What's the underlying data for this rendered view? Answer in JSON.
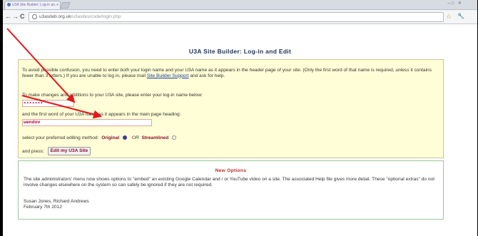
{
  "browser": {
    "tab_title": "U3A Site Builder: Log-in an...",
    "tab_close": "×",
    "window_controls": "–□ ✕",
    "back_icon": "←",
    "forward_icon": "→",
    "reload_icon": "C",
    "url_host": "u3asiteb.org.uk",
    "url_path": "/u3asites/code/login.php",
    "star_icon": "☆",
    "wrench_icon": "🔧"
  },
  "page": {
    "title": "U3A Site Builder: Log-in and Edit",
    "login": {
      "intro_before": "To avoid possible confusion, you need to enter ",
      "intro_em1": "both",
      "intro_mid1": " your login name and your U3A name as it appears in the header page of your site. (Only the first word of that name is required, ",
      "intro_em2": "unless",
      "intro_mid2": " it contains fewer than 3 letters.) If you are unable to log in, please mail ",
      "support_link": "Site Builder Support",
      "intro_after": " and ask for help.",
      "login_label": "To make changes and additions to your U3A site, please enter your log-in name below:",
      "login_value": "•••••••",
      "u3a_label": "and the first word of your U3A name as it appears in the main page heading:",
      "u3a_value": "wendov",
      "method_label": "select your preferred editing method:",
      "option_original": "Original",
      "or_text": "OR",
      "option_streamlined": "Streamlined",
      "press_label": "and press:",
      "submit_label": "Edit my U3A Site"
    },
    "news": {
      "title": "New Options",
      "text": "The site administrators' menu now shows options to \"embed\" an existing Google Calendar and / or YouTube video on a site. The associated Help file gives more detail. These \"optional extras\" do not involve changes elsewhere on the system so can safely be ignored if they are not required.",
      "authors": "Susan Jones, Richard Andrews",
      "date": "February 7th 2012"
    }
  },
  "annotation_color": "#e8141c"
}
